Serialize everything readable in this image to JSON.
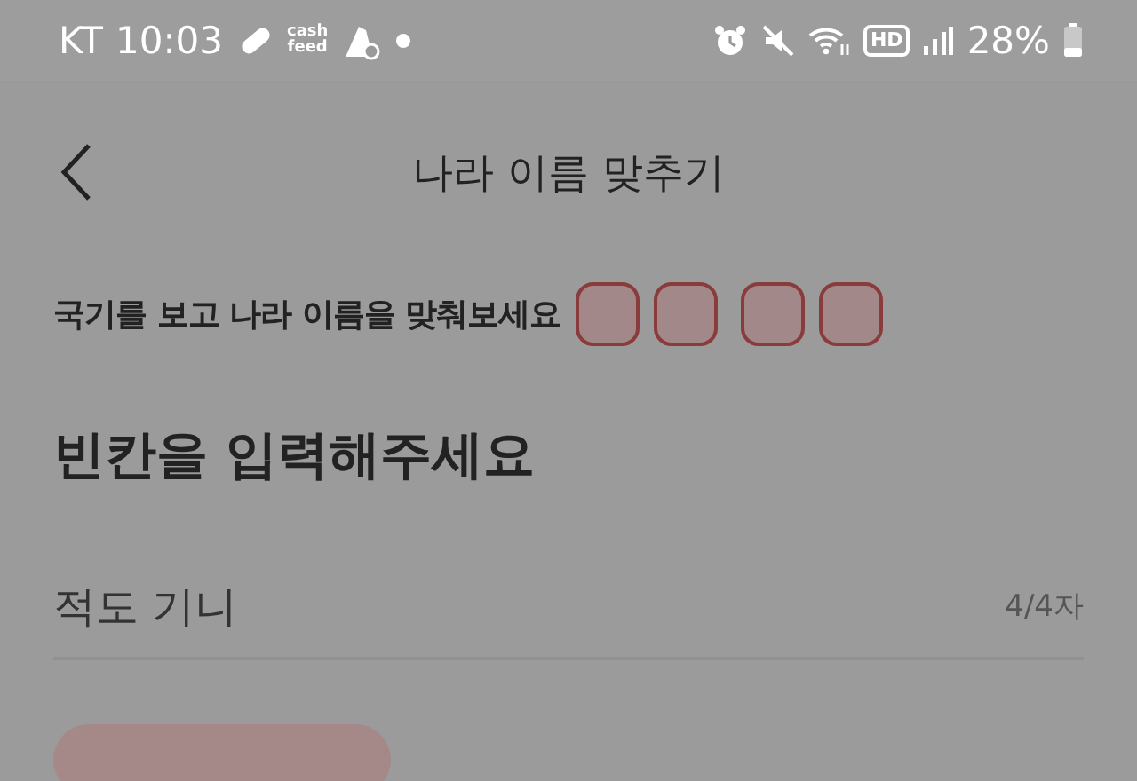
{
  "status_bar": {
    "carrier": "KT",
    "time": "10:03",
    "app_logo": [
      "cash",
      "feed"
    ],
    "hd_label": "HD",
    "battery": "28%"
  },
  "header": {
    "title": "나라 이름 맞추기"
  },
  "question": {
    "text": "국기를 보고 나라 이름을 맞춰보세요",
    "words": [
      {
        "boxes": [
          {
            "kind": "blank"
          },
          {
            "kind": "blank"
          }
        ]
      },
      {
        "boxes": [
          {
            "kind": "blank"
          },
          {
            "kind": "blank"
          }
        ]
      }
    ]
  },
  "heading": "빈칸을 입력해주세요",
  "answer_field": {
    "value": "적도 기니",
    "counter": "4/4자"
  },
  "hint_button": {
    "kind": "pill"
  }
}
